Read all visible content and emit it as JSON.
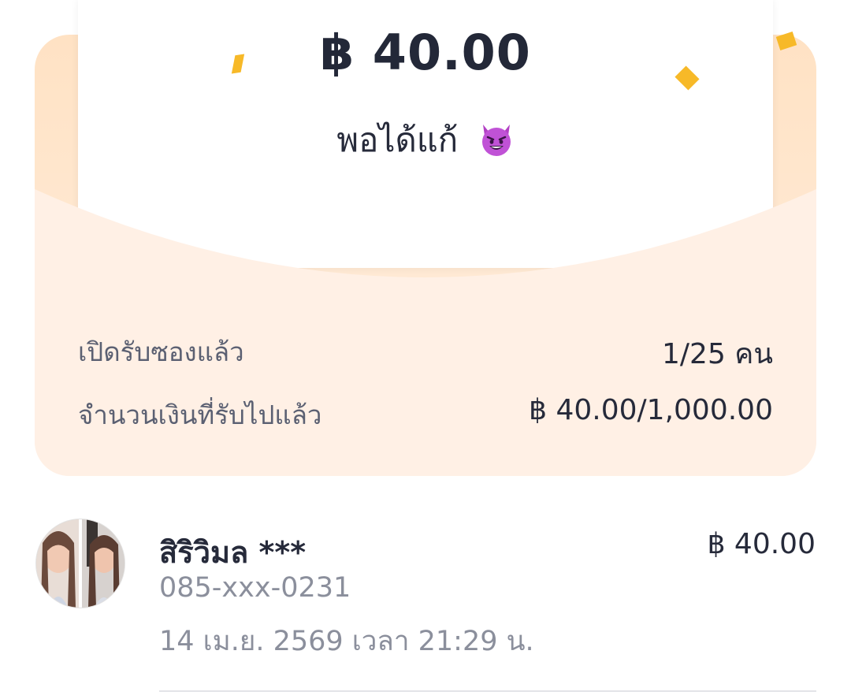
{
  "packet": {
    "amount": "฿ 40.00",
    "message": "พอได้แก้",
    "message_emoji": "smiling-face-with-horns-icon"
  },
  "stats": {
    "opened_label": "เปิดรับซองแล้ว",
    "opened_value": "1/25 คน",
    "received_label": "จำนวนเงินที่รับไปแล้ว",
    "received_value": "฿ 40.00/1,000.00"
  },
  "recipients": [
    {
      "name": "สิริวิมล ***",
      "phone": "085-xxx-0231",
      "time": "14 เม.ย. 2569 เวลา 21:29 น.",
      "amount": "฿ 40.00"
    }
  ],
  "colors": {
    "accent_confetti": "#f7b928",
    "envelope_peach": "#ffe2c4",
    "envelope_light": "#fff0e4",
    "text_primary": "#262a3a",
    "text_secondary": "#8b8f9c"
  }
}
